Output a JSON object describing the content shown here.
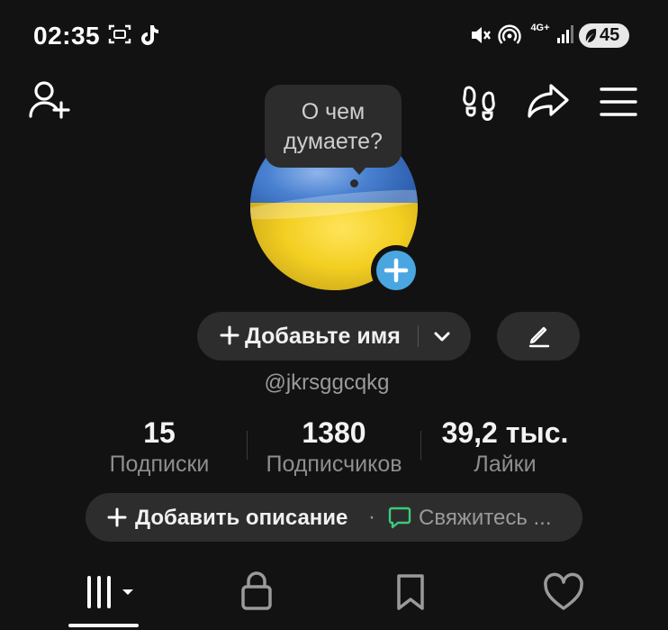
{
  "status_bar": {
    "time": "02:35",
    "network": "4G+",
    "battery": "45",
    "icons": [
      "screenshot-icon",
      "tiktok-icon",
      "mute-icon",
      "hotspot-icon",
      "signal-icon",
      "battery-saver-icon"
    ]
  },
  "toolbar": {
    "icons": [
      "add-user-icon",
      "footprints-icon",
      "share-icon",
      "menu-icon"
    ]
  },
  "bubble": {
    "line1": "О чем",
    "line2": "думаете?"
  },
  "profile": {
    "add_name_label": "Добавьте имя",
    "username": "@jkrsggcqkg"
  },
  "stats": [
    {
      "value": "15",
      "label": "Подписки"
    },
    {
      "value": "1380",
      "label": "Подписчиков"
    },
    {
      "value": "39,2 тыс.",
      "label": "Лайки"
    }
  ],
  "description_bar": {
    "add_label": "Добавить описание",
    "separator": "·",
    "contact_label": "Свяжитесь ..."
  },
  "tabs": [
    {
      "icon": "videos-grid-icon",
      "active": true
    },
    {
      "icon": "lock-icon",
      "active": false
    },
    {
      "icon": "bookmark-icon",
      "active": false
    },
    {
      "icon": "heart-icon",
      "active": false
    }
  ],
  "colors": {
    "background": "#121212",
    "pill": "#2d2d2d",
    "accent_blue": "#4aa6e0",
    "accent_green": "#3cc97a"
  }
}
